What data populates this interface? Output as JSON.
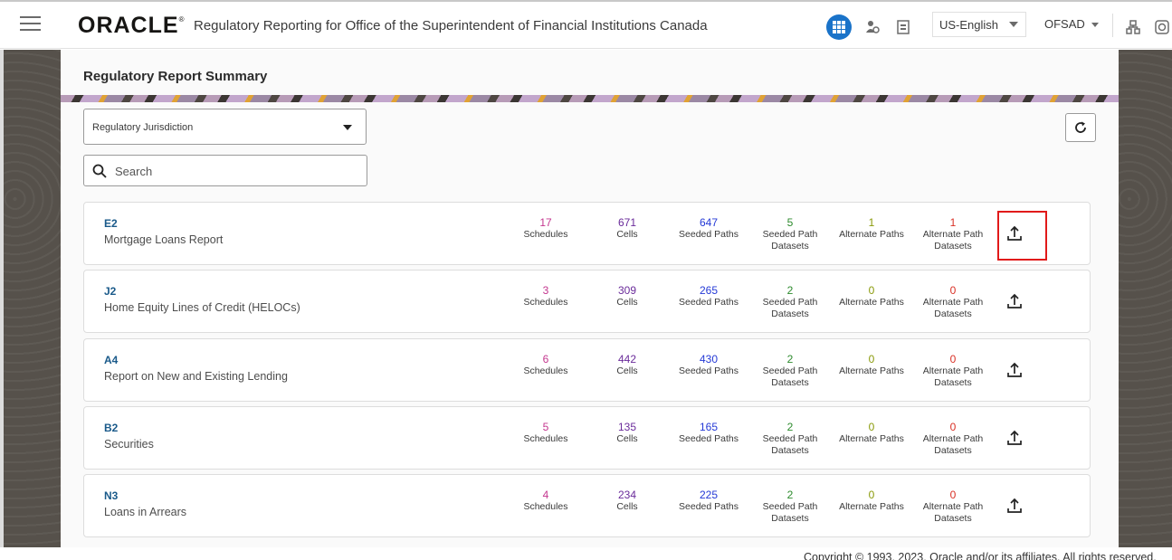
{
  "header": {
    "logo": "ORACLE",
    "logo_mark": "®",
    "app_title": "Regulatory Reporting for Office of the Superintendent of Financial Institutions Canada",
    "language": "US-English",
    "user": "OFSAD"
  },
  "page": {
    "title": "Regulatory Report Summary",
    "jurisdiction_label": "Regulatory Jurisdiction",
    "search_placeholder": "Search"
  },
  "stat_labels": {
    "schedules": "Schedules",
    "cells": "Cells",
    "seeded_paths": "Seeded Paths",
    "seeded_path_datasets_1": "Seeded Path",
    "seeded_path_datasets_2": "Datasets",
    "alternate_paths": "Alternate Paths",
    "alternate_path_datasets_1": "Alternate Path",
    "alternate_path_datasets_2": "Datasets"
  },
  "reports": [
    {
      "code": "E2",
      "name": "Mortgage Loans Report",
      "schedules": "17",
      "cells": "671",
      "seeded_paths": "647",
      "seeded_path_datasets": "5",
      "alternate_paths": "1",
      "alternate_path_datasets": "1"
    },
    {
      "code": "J2",
      "name": "Home Equity Lines of Credit (HELOCs)",
      "schedules": "3",
      "cells": "309",
      "seeded_paths": "265",
      "seeded_path_datasets": "2",
      "alternate_paths": "0",
      "alternate_path_datasets": "0"
    },
    {
      "code": "A4",
      "name": "Report on New and Existing Lending",
      "schedules": "6",
      "cells": "442",
      "seeded_paths": "430",
      "seeded_path_datasets": "2",
      "alternate_paths": "0",
      "alternate_path_datasets": "0"
    },
    {
      "code": "B2",
      "name": "Securities",
      "schedules": "5",
      "cells": "135",
      "seeded_paths": "165",
      "seeded_path_datasets": "2",
      "alternate_paths": "0",
      "alternate_path_datasets": "0"
    },
    {
      "code": "N3",
      "name": "Loans in Arrears",
      "schedules": "4",
      "cells": "234",
      "seeded_paths": "225",
      "seeded_path_datasets": "2",
      "alternate_paths": "0",
      "alternate_path_datasets": "0"
    }
  ],
  "footer": {
    "copyright": "Copyright © 1993, 2023, Oracle and/or its affiliates. All rights reserved."
  },
  "icons": {
    "menu": "hamburger-icon",
    "apps": "grid-icon",
    "user": "user-icon",
    "doc": "document-icon",
    "network": "network-icon",
    "help": "help-icon",
    "refresh": "refresh-icon",
    "search": "search-icon",
    "upload": "upload-icon"
  },
  "colors": {
    "schedules": "#c4378f",
    "cells": "#6a2b9a",
    "seeded_paths": "#2439d6",
    "seeded_path_datasets": "#2c8a2c",
    "alternate_paths": "#8a9a0a",
    "alternate_path_datasets": "#d93025",
    "highlight": "#e11a1a"
  }
}
